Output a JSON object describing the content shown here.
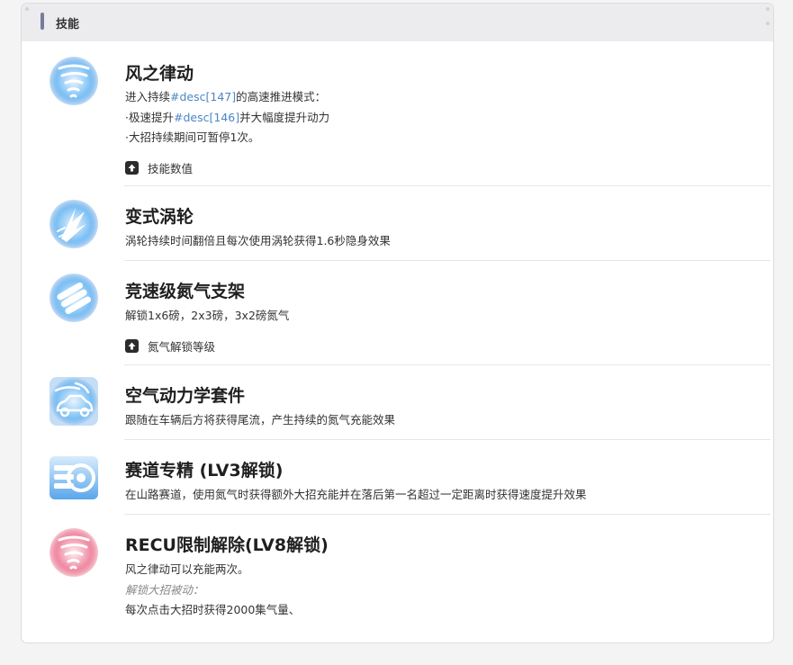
{
  "section": {
    "title": "技能"
  },
  "skills": [
    {
      "title": "风之律动",
      "icon": "tornado-icon",
      "lines": [
        {
          "a": "进入持续",
          "b": "#desc[147]",
          "c": "的高速推进模式："
        },
        {
          "a": "·极速提升",
          "b": "#desc[146]",
          "c": "并大幅度提升动力"
        },
        {
          "a": "·大招持续期间可暂停1次。",
          "b": "",
          "c": ""
        }
      ],
      "toggle": "技能数值"
    },
    {
      "title": "变式涡轮",
      "icon": "turbo-flame-icon",
      "lines": [
        {
          "a": "涡轮持续时间翻倍且每次使用涡轮获得1.6秒隐身效果"
        }
      ]
    },
    {
      "title": "竞速级氮气支架",
      "icon": "nitro-tanks-icon",
      "lines": [
        {
          "a": "解锁1x6磅，2x3磅，3x2磅氮气"
        }
      ],
      "toggle": "氮气解锁等级"
    },
    {
      "title": "空气动力学套件",
      "icon": "aero-car-icon",
      "lines": [
        {
          "a": "跟随在车辆后方将获得尾流，产生持续的氮气充能效果"
        }
      ]
    },
    {
      "title": "赛道专精 (LV3解锁)",
      "icon": "tire-icon",
      "lines": [
        {
          "a": "在山路赛道，使用氮气时获得额外大招充能并在落后第一名超过一定距离时获得速度提升效果"
        }
      ]
    },
    {
      "title": "RECU限制解除(LV8解锁)",
      "icon": "red-tornado-icon",
      "lines": [
        {
          "a": "风之律动可以充能两次。"
        }
      ],
      "italic": "解锁大招被动：",
      "extra": "每次点击大招时获得2000集气量、"
    }
  ],
  "colors": {
    "blue_glow": "#3b8fe0",
    "red_glow": "#e04a6a",
    "link": "#4a86c7"
  }
}
